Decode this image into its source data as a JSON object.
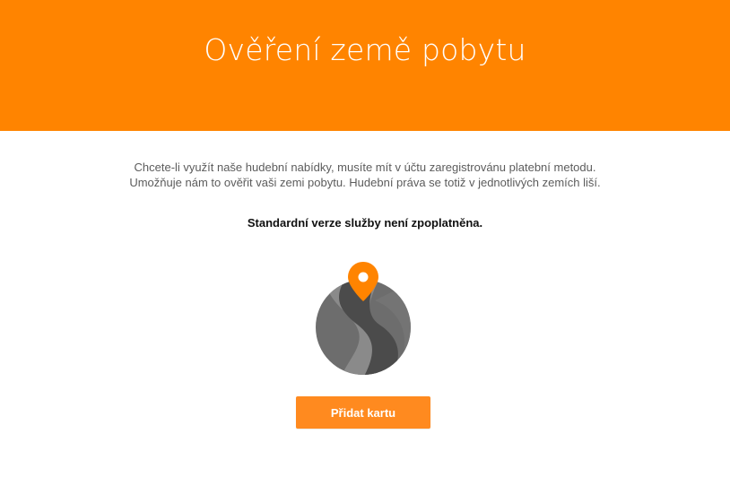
{
  "header": {
    "title": "Ověření země pobytu",
    "background_color": "#ff8400"
  },
  "main": {
    "description_line1": "Chcete-li využít naše hudební nabídky, musíte mít v účtu zaregistrovánu platební metodu.",
    "description_line2": "Umožňuje nám to ověřit vaši zemi pobytu. Hudební práva se totiž v jednotlivých zemích liší.",
    "note": "Standardní verze služby není zpoplatněna.",
    "illustration_icon": "globe-location-pin-icon",
    "add_card_button_label": "Přidat kartu",
    "button_color": "#ff8a1f"
  }
}
